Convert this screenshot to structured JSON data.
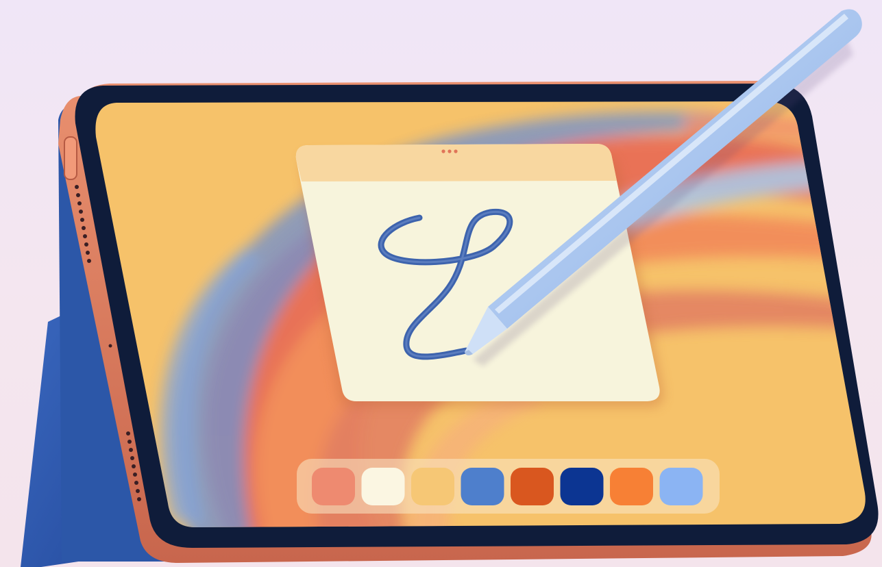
{
  "scene": {
    "subject": "tablet-with-stylus",
    "colors": {
      "background_top": "#f0e6f7",
      "background_bottom": "#f4e4ec",
      "bezel": "#0f1c3a",
      "frame": "#d8795e",
      "case": "#2f5db3",
      "screen_base": "#f6c26a",
      "note_body": "#f7f4dc",
      "note_header": "#f8d7a0",
      "squiggle": "#3d63ad",
      "stylus": "#b8d0f2"
    }
  },
  "note_window": {
    "menu_dots_icon": "ellipsis-icon",
    "drawing": "squiggle-stroke"
  },
  "palette": {
    "swatches": [
      {
        "name": "coral",
        "color": "#ee8a70"
      },
      {
        "name": "cream",
        "color": "#fbf6e2"
      },
      {
        "name": "sand",
        "color": "#f6c775"
      },
      {
        "name": "blue",
        "color": "#4e7fcc"
      },
      {
        "name": "rust",
        "color": "#d9571f"
      },
      {
        "name": "navy",
        "color": "#0c3592"
      },
      {
        "name": "orange",
        "color": "#f78035"
      },
      {
        "name": "sky",
        "color": "#8bb4f3"
      }
    ]
  }
}
